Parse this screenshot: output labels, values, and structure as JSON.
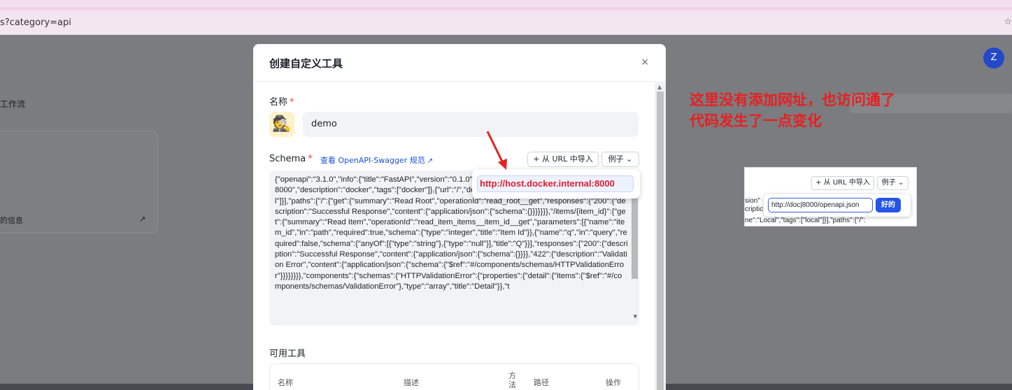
{
  "browser": {
    "address": "s?category=api",
    "star_icon": "☆"
  },
  "background": {
    "sidebar_label": "工作流",
    "card_text": "的信息",
    "card_arrow": "↗",
    "avatar_letter": "Z"
  },
  "modal": {
    "title": "创建自定义工具",
    "close": "×",
    "name_label": "名称",
    "required_mark": "*",
    "name_icon": "🕵",
    "name_value": "demo",
    "schema_label": "Schema",
    "swagger_link": "查看 OpenAPI-Swagger 规范",
    "ext_icon": "↗",
    "import_button": "+ 从 URL 中导入",
    "example_button": "例子 ⌄",
    "schema_content": "{\"openapi\":\"3.1.0\",\"info\":{\"title\":\"FastAPI\",\"version\":\"0.1.0\"},\"servers\":[{\"url\":\"http://host.docker.internal:8000\",\"description\":\"docker\",\"tags\":[\"docker\"]},{\"url\":\"/\",\"description\":\"Local\",\"name\":\"Local\",\"tag\":[\"local\"]}],\"paths\":{\"/\":{\"get\":{\"summary\":\"Read Root\",\"operationId\":\"read_root__get\",\"responses\":{\"200\":{\"description\":\"Successful Response\",\"content\":{\"application/json\":{\"schema\":{}}}}}}},\"/items/{item_id}\":{\"get\":{\"summary\":\"Read Item\",\"operationId\":\"read_item_items__item_id__get\",\"parameters\":[{\"name\":\"item_id\",\"in\":\"path\",\"required\":true,\"schema\":{\"type\":\"integer\",\"title\":\"Item Id\"}},{\"name\":\"q\",\"in\":\"query\",\"required\":false,\"schema\":{\"anyOf\":[{\"type\":\"string\"},{\"type\":\"null\"}],\"title\":\"Q\"}}],\"responses\":{\"200\":{\"description\":\"Successful Response\",\"content\":{\"application/json\":{\"schema\":{}}}},\"422\":{\"description\":\"Validation Error\",\"content\":{\"application/json\":{\"schema\":{\"$ref\":\"#/components/schemas/HTTPValidationError\"}}}}}}}},\"components\":{\"schemas\":{\"HTTPValidationError\":{\"properties\":{\"detail\":{\"items\":{\"$ref\":\"#/components/schemas/ValidationError\"},\"type\":\"array\",\"title\":\"Detail\"}},\"t",
    "url_popup_value": "http://host.docker.internal:8000",
    "tools_label": "可用工具",
    "table_headers": [
      "名称",
      "描述",
      "方法",
      "路径",
      "操作"
    ]
  },
  "annotation": {
    "line1": "这里没有添加网址，也访问通了",
    "line2": "代码发生了一点变化",
    "color": "#e62020"
  },
  "inset": {
    "import_button": "+ 从 URL 中导入",
    "example_button": "例子 ⌄",
    "side_text": "sion\"\ncriptic",
    "bottom_text": "ne\":\"Local\",\"tags\":[\"local\"]}],\"paths\":{\"/\":",
    "url_value": "http://doc|8000/openapi.json",
    "ok_button": "好的"
  }
}
